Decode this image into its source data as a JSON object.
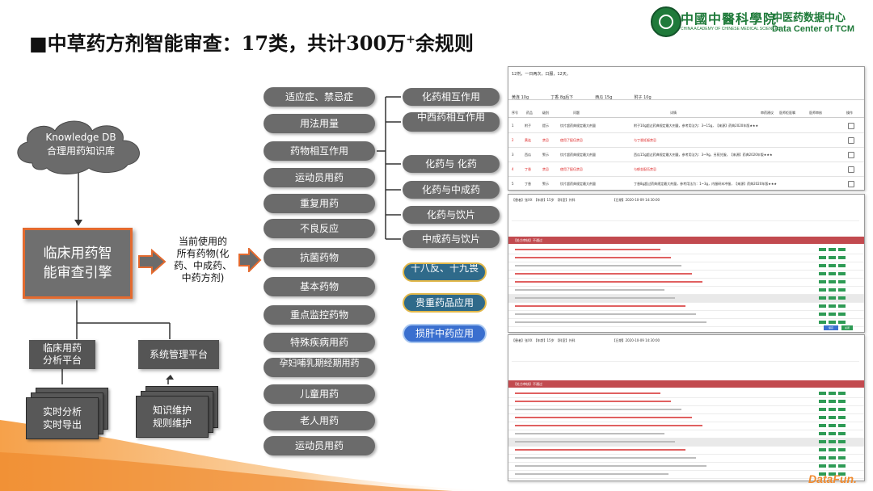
{
  "header": {
    "title_main": "■中草药方剂智能审查：17类，共计300万",
    "title_sup": "+",
    "title_tail": "余规则"
  },
  "logo": {
    "cn_name": "中國中醫科學院",
    "en_name": "CHINA ACADEMY OF CHINESE MEDICAL SCIENCES",
    "center_cn": "中医药数据中心",
    "center_en": "Data Center of TCM"
  },
  "left": {
    "knowledge_db_line1": "Knowledge DB",
    "knowledge_db_line2": "合理用药知识库",
    "engine_line1": "临床用药智",
    "engine_line2": "能审查引擎",
    "current_line1": "当前使用的",
    "current_line2": "所有药物(化",
    "current_line3": "药、中成药、",
    "current_line4": "中药方剂)",
    "analysis_platform_line1": "临床用药",
    "analysis_platform_line2": "分析平台",
    "system_platform": "系统管理平台",
    "doc1_line1": "实时分析",
    "doc1_line2": "实时导出",
    "doc2_line1": "知识维护",
    "doc2_line2": "规则维护"
  },
  "categories": [
    "适应症、禁忌症",
    "用法用量",
    "药物相互作用",
    "运动员用药",
    "重复用药",
    "不良反应",
    "抗菌药物",
    "基本药物",
    "重点监控药物",
    "特殊疾病用药",
    "孕妇哺乳期经期用药",
    "儿童用药",
    "老人用药",
    "运动员用药"
  ],
  "interactions": [
    "化药相互作用",
    "中西药相互作用",
    "化药与 化药",
    "化药与中成药",
    "化药与饮片",
    "中成药与饮片"
  ],
  "special": [
    "十八反、十九畏",
    "贵重药品应用",
    "损肝中药应用"
  ],
  "screenshot1": {
    "header_line": "12剂，一日两次，口服，12天。",
    "herbs": [
      "黄连 10g",
      "丁香 8g后下",
      "西瓜 15g",
      "附子 10g"
    ],
    "columns": [
      "序号",
      "药品",
      "级别",
      "问题",
      "详情",
      "审药建议",
      "医师拒医嘱",
      "医师审核",
      "操作"
    ],
    "rows": [
      {
        "no": "1",
        "drug": "附子",
        "level": "提示",
        "issue": "饮片超药典规定最大剂量",
        "detail": "附子10g超过药典规定最大剂量，参考用法为：3~15g，【来源】药典2020年版★★★",
        "red": false
      },
      {
        "no": "2",
        "drug": "黄连",
        "level": "禁忌",
        "issue": "使用了配伍禁忌",
        "detail": "与丁香妊娠禁忌",
        "red": true
      },
      {
        "no": "3",
        "drug": "西瓜",
        "level": "警示",
        "issue": "饮片超药典规定最大剂量",
        "detail": "西瓜15g超过药典规定最大剂量，参考用法为：3~9g，另煎兑服，【来源】药典2020年版★★★",
        "red": false
      },
      {
        "no": "4",
        "drug": "丁香",
        "level": "禁忌",
        "issue": "使用了配伍禁忌",
        "detail": "与郁金配伍禁忌",
        "red": true
      },
      {
        "no": "5",
        "drug": "丁香",
        "level": "警示",
        "issue": "饮片超药典规定最大剂量",
        "detail": "丁香8g超过药典规定最大剂量，参考用法为：1~3g，内服研末冲服，【来源】药典2020年版★★★",
        "red": false
      }
    ]
  },
  "screenshot2": {
    "patient": "张XX",
    "age": "15岁",
    "dept": "外科",
    "date": "2020-10-09 14:30:00",
    "bar": "【处方审核】不通过",
    "buttons": [
      "保存",
      "关闭"
    ]
  },
  "screenshot3": {
    "patient": "张XX",
    "age": "15岁",
    "dept": "外科",
    "date": "2020-10-09 14:30:00",
    "bar": "【处方审核】不通过"
  },
  "watermark": "DataFun."
}
